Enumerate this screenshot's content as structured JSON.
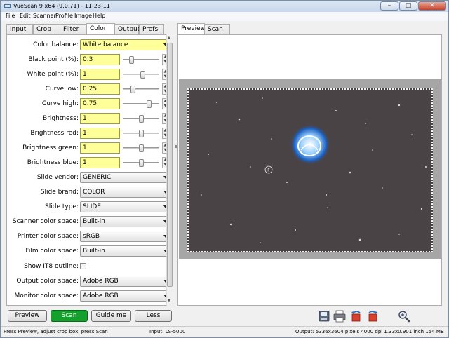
{
  "window": {
    "title": "VueScan 9 x64 (9.0.71) - 11-23-11"
  },
  "menu": [
    "File",
    "Edit",
    "Scanner",
    "Profile",
    "Image",
    "Help"
  ],
  "tabs": [
    {
      "label": "Input"
    },
    {
      "label": "Crop"
    },
    {
      "label": "Filter"
    },
    {
      "label": "Color",
      "active": true
    },
    {
      "label": "Output"
    },
    {
      "label": "Prefs"
    }
  ],
  "preview_tabs": [
    {
      "label": "Preview",
      "active": true
    },
    {
      "label": "Scan"
    }
  ],
  "color_panel": {
    "color_balance": {
      "label": "Color balance:",
      "value": "White balance"
    },
    "fields": [
      {
        "label": "Black point (%):",
        "value": "0.3",
        "slider": 0.2
      },
      {
        "label": "White point (%):",
        "value": "1",
        "slider": 0.55
      },
      {
        "label": "Curve low:",
        "value": "0.25",
        "slider": 0.25
      },
      {
        "label": "Curve high:",
        "value": "0.75",
        "slider": 0.75
      },
      {
        "label": "Brightness:",
        "value": "1",
        "slider": 0.5
      },
      {
        "label": "Brightness red:",
        "value": "1",
        "slider": 0.5
      },
      {
        "label": "Brightness green:",
        "value": "1",
        "slider": 0.5
      },
      {
        "label": "Brightness blue:",
        "value": "1",
        "slider": 0.5
      }
    ],
    "selects": [
      {
        "label": "Slide vendor:",
        "value": "GENERIC"
      },
      {
        "label": "Slide brand:",
        "value": "COLOR"
      },
      {
        "label": "Slide type:",
        "value": "SLIDE"
      },
      {
        "label": "Scanner color space:",
        "value": "Built-in"
      },
      {
        "label": "Printer color space:",
        "value": "sRGB"
      },
      {
        "label": "Film color space:",
        "value": "Built-in"
      }
    ],
    "it8": {
      "label": "Show IT8 outline:",
      "checked": false
    },
    "selects2": [
      {
        "label": "Output color space:",
        "value": "Adobe RGB"
      },
      {
        "label": "Monitor color space:",
        "value": "Adobe RGB"
      }
    ]
  },
  "buttons": {
    "preview": "Preview",
    "scan": "Scan",
    "guide": "Guide me",
    "less": "Less"
  },
  "toolbar_icons": [
    "save-icon",
    "print-icon",
    "rotate-left-icon",
    "rotate-right-icon",
    "zoom-icon"
  ],
  "focus_marker": "F",
  "status": {
    "left": "Press Preview, adjust crop box, press Scan",
    "middle": "Input: LS-5000",
    "right": "Output: 5336x3604 pixels 4000 dpi 1.33x0.901 inch 154 MB"
  }
}
